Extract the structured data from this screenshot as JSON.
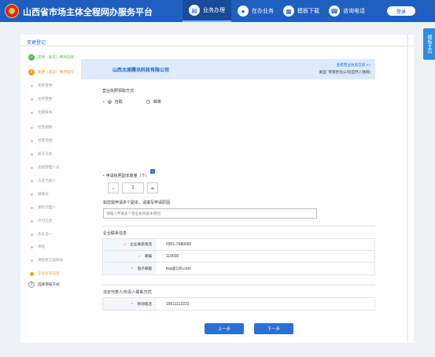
{
  "header": {
    "site_title": "山西省市场主体全程网办服务平台",
    "nav": [
      {
        "label": "业务办理",
        "icon": "doc-icon"
      },
      {
        "label": "在办业务",
        "icon": "person-icon"
      },
      {
        "label": "模板下载",
        "icon": "template-icon"
      },
      {
        "label": "咨询电话",
        "icon": "phone-icon"
      }
    ],
    "login_label": "登录"
  },
  "float_tab": "模板主页",
  "panel_title": "变更登记",
  "steps": [
    {
      "label": "变更（备案）事项选择",
      "state": "done"
    },
    {
      "label": "变更（备案）事项填写",
      "state": "current",
      "num": "2"
    },
    {
      "label": "名称变更",
      "state": "sub"
    },
    {
      "label": "住所变更",
      "state": "sub"
    },
    {
      "label": "注册资本",
      "state": "sub"
    },
    {
      "label": "经营期限",
      "state": "sub"
    },
    {
      "label": "经营范围",
      "state": "sub"
    },
    {
      "label": "股东信息",
      "state": "sub"
    },
    {
      "label": "高级管理人员",
      "state": "sub"
    },
    {
      "label": "法定代表人",
      "state": "sub"
    },
    {
      "label": "联络员",
      "state": "sub"
    },
    {
      "label": "委托代理人",
      "state": "sub"
    },
    {
      "label": "许可信息",
      "state": "sub"
    },
    {
      "label": "多证合一",
      "state": "sub"
    },
    {
      "label": "章程",
      "state": "sub"
    },
    {
      "label": "章程修正案附表",
      "state": "sub"
    },
    {
      "label": "企业补充信息",
      "state": "sub-active"
    },
    {
      "label": "选择审核方式",
      "state": "todo",
      "num": "3"
    }
  ],
  "banner": {
    "company_name": "山西太原腾讯科技有限公司",
    "link": "查看营业执照信息 >>",
    "type_label": "类型:",
    "type_value": "有限责任公司(自然人独资)"
  },
  "license_method": {
    "title": "营业执照领取方式",
    "options": [
      "自取",
      "邮寄"
    ],
    "selected": "自取"
  },
  "copies": {
    "label": "申请执照副本数量（个）",
    "help": "?",
    "minus": "-",
    "value": "1",
    "plus": "+"
  },
  "copy_reason": {
    "label": "如您需申请多个副本，请填写申请原因",
    "placeholder": "请输入申请多个营业执照副本原因"
  },
  "contact": {
    "title": "企业联系信息",
    "rows": [
      {
        "label": "企业联系电话",
        "value": "0351-7680282"
      },
      {
        "label": "邮编",
        "value": "110030"
      },
      {
        "label": "电子邮箱",
        "value": "lisa@126.com"
      }
    ]
  },
  "legal_rep": {
    "title": "法定代表人/负责人联系方式",
    "rows": [
      {
        "label": "移动电话",
        "value": "15011112222"
      }
    ]
  },
  "buttons": {
    "prev": "上一步",
    "next": "下一步"
  }
}
